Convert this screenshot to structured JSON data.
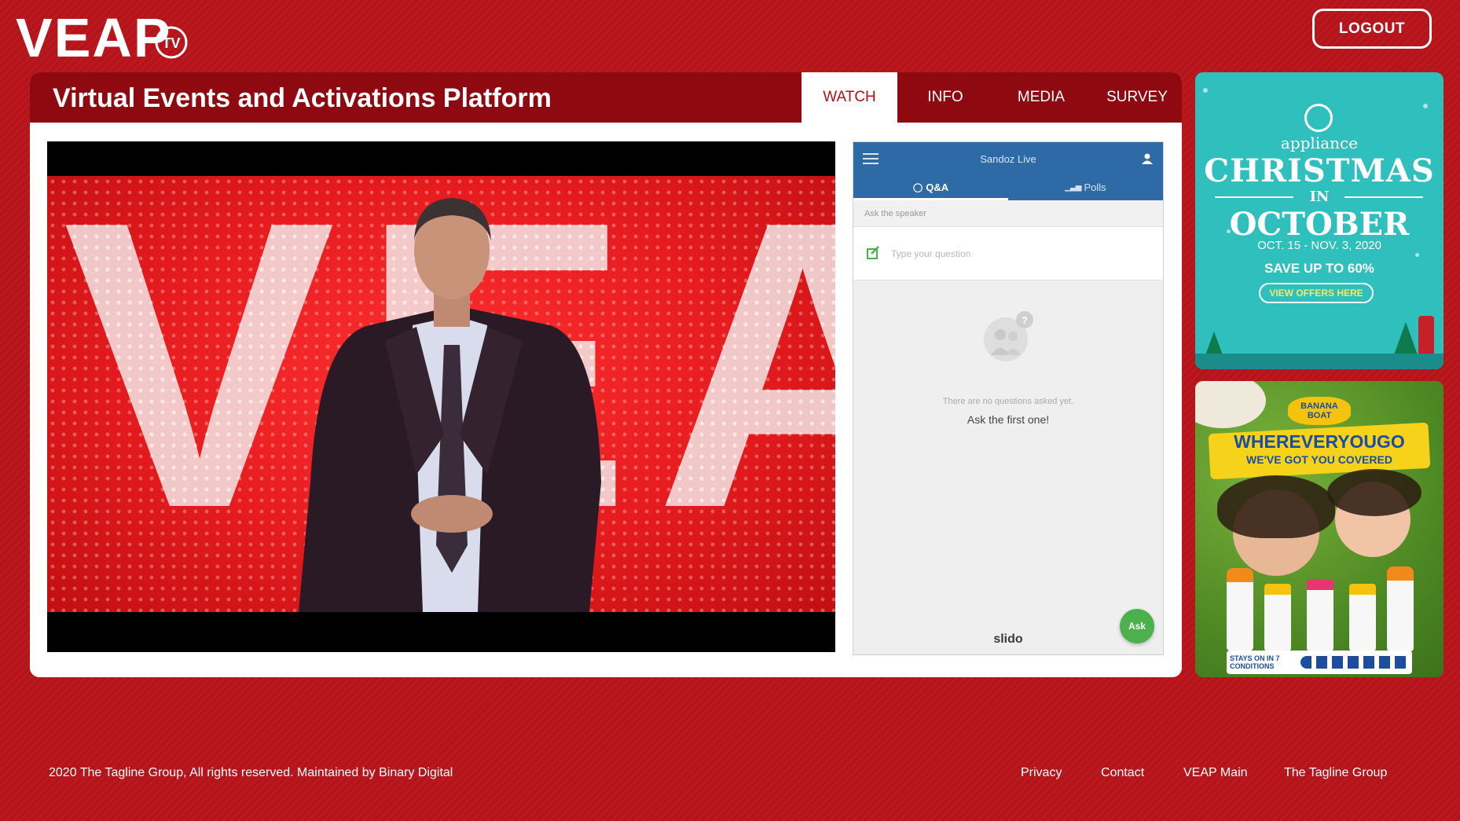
{
  "header": {
    "logo_text": "VEAP",
    "logo_badge": "TV",
    "logout_label": "LOGOUT"
  },
  "panel": {
    "title": "Virtual Events and Activations Platform",
    "tabs": [
      {
        "label": "WATCH",
        "active": true
      },
      {
        "label": "INFO",
        "active": false
      },
      {
        "label": "MEDIA",
        "active": false
      },
      {
        "label": "SURVEY",
        "active": false
      }
    ]
  },
  "video": {
    "backdrop_text": "VEA"
  },
  "slido": {
    "event_name": "Sandoz Live",
    "tabs": [
      {
        "label": "Q&A",
        "icon": "qa-icon",
        "active": true
      },
      {
        "label": "Polls",
        "icon": "poll-icon",
        "active": false
      }
    ],
    "ask_label": "Ask the speaker",
    "question_value": "",
    "question_placeholder": "Type your question",
    "empty_text": "There are no questions asked yet.",
    "empty_cta": "Ask the first one!",
    "brand": "slido",
    "ask_button": "Ask"
  },
  "ads": {
    "ad1": {
      "brand": "appliance",
      "title_line1": "CHRISTMAS",
      "title_in": "IN",
      "title_line2": "OCTOBER",
      "dates": "OCT. 15 - NOV. 3, 2020",
      "save": "SAVE UP TO 60%",
      "cta": "VIEW OFFERS HERE"
    },
    "ad2": {
      "brand": "BANANA BOAT",
      "headline": "WHEREVERYOUGO",
      "subline": "WE'VE GOT YOU COVERED",
      "footer": "STAYS ON IN 7 CONDITIONS"
    }
  },
  "footer": {
    "copyright": "2020 The Tagline Group, All rights reserved. Maintained by Binary Digital",
    "links": [
      "Privacy",
      "Contact",
      "VEAP Main",
      "The Tagline Group"
    ]
  },
  "colors": {
    "background": "#b5141a",
    "panel_header": "#8f0a10",
    "active_tab_text": "#b01119",
    "slido_blue": "#2e6aa6",
    "ask_green": "#4cb04c",
    "ad1_teal": "#2fbfbd"
  }
}
